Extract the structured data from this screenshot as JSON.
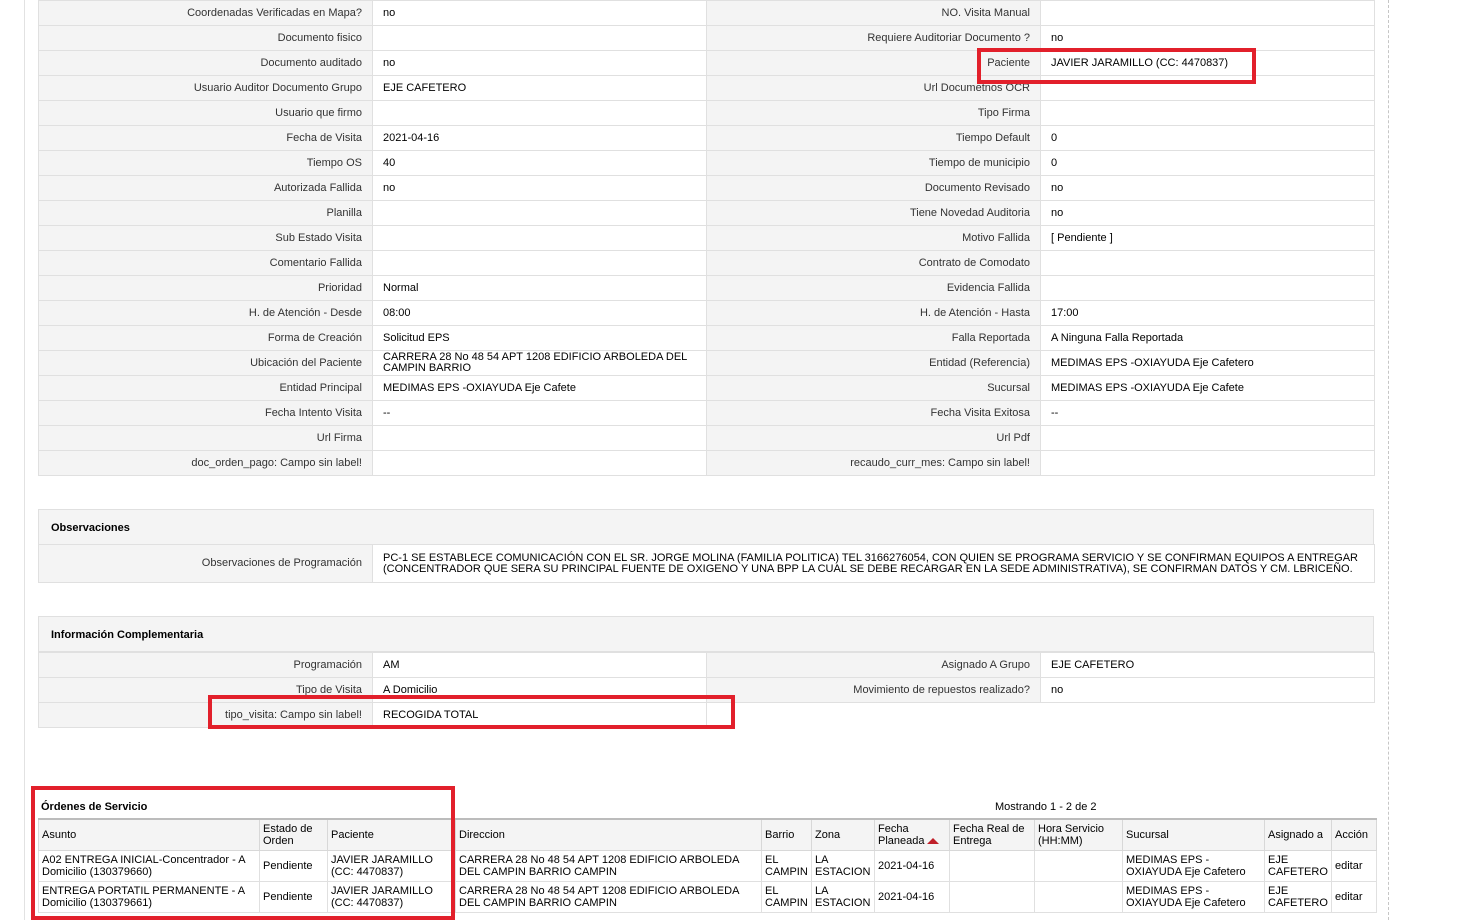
{
  "details": {
    "rows": [
      {
        "l1": "Coordenadas Verificadas en Mapa?",
        "v1": "no",
        "l2": "NO. Visita Manual",
        "v2": ""
      },
      {
        "l1": "Documento fisico",
        "v1": "",
        "l2": "Requiere Auditoriar Documento ?",
        "v2": "no"
      },
      {
        "l1": "Documento auditado",
        "v1": "no",
        "l2": "Paciente",
        "v2": "JAVIER JARAMILLO (CC: 4470837)"
      },
      {
        "l1": "Usuario Auditor Documento Grupo",
        "v1": "EJE CAFETERO",
        "l2": "Url Documetnos OCR",
        "v2": ""
      },
      {
        "l1": "Usuario que firmo",
        "v1": "",
        "l2": "Tipo Firma",
        "v2": ""
      },
      {
        "l1": "Fecha de Visita",
        "v1": " 2021-04-16",
        "l2": "Tiempo Default",
        "v2": "0"
      },
      {
        "l1": "Tiempo OS",
        "v1": "40",
        "l2": "Tiempo de municipio",
        "v2": "0"
      },
      {
        "l1": "Autorizada Fallida",
        "v1": "no",
        "l2": "Documento Revisado",
        "v2": "no"
      },
      {
        "l1": "Planilla",
        "v1": "",
        "l2": "Tiene Novedad Auditoria",
        "v2": "no"
      },
      {
        "l1": "Sub Estado Visita",
        "v1": "",
        "l2": "Motivo Fallida",
        "v2": "[ Pendiente ]"
      },
      {
        "l1": "Comentario Fallida",
        "v1": "",
        "l2": "Contrato de Comodato",
        "v2": ""
      },
      {
        "l1": "Prioridad",
        "v1": "Normal",
        "l2": "Evidencia Fallida",
        "v2": ""
      },
      {
        "l1": "H. de Atención - Desde",
        "v1": "08:00",
        "l2": "H. de Atención - Hasta",
        "v2": "17:00"
      },
      {
        "l1": "Forma de Creación",
        "v1": "Solicitud EPS",
        "l2": "Falla Reportada",
        "v2": "A Ninguna Falla Reportada"
      },
      {
        "l1": "Ubicación del Paciente",
        "v1": "CARRERA 28 No 48 54 APT 1208 EDIFICIO ARBOLEDA DEL CAMPIN BARRIO",
        "l2": "Entidad (Referencia)",
        "v2": "MEDIMAS EPS -OXIAYUDA Eje Cafetero"
      },
      {
        "l1": "Entidad Principal",
        "v1": "MEDIMAS EPS -OXIAYUDA Eje Cafete",
        "l2": "Sucursal",
        "v2": "MEDIMAS EPS -OXIAYUDA Eje Cafete"
      },
      {
        "l1": "Fecha Intento Visita",
        "v1": "--",
        "l2": "Fecha Visita Exitosa",
        "v2": "--"
      },
      {
        "l1": "Url Firma",
        "v1": "",
        "l2": "Url Pdf",
        "v2": ""
      },
      {
        "l1": "doc_orden_pago: Campo sin label!",
        "v1": "",
        "l2": "recaudo_curr_mes: Campo sin label!",
        "v2": ""
      }
    ]
  },
  "observaciones": {
    "title": "Observaciones",
    "label": "Observaciones de Programación",
    "text": "PC-1 SE ESTABLECE COMUNICACIÓN CON EL SR. JORGE MOLINA (FAMILIA POLITICA) TEL 3166276054, CON QUIEN SE PROGRAMA SERVICIO Y SE CONFIRMAN EQUIPOS A ENTREGAR (CONCENTRADOR QUE SERA SU PRINCIPAL FUENTE DE OXIGENO Y UNA BPP LA CUAL SE DEBE RECARGAR EN LA SEDE ADMINISTRATIVA), SE CONFIRMAN DATOS Y CM. LBRICEÑO."
  },
  "complementaria": {
    "title": "Información Complementaria",
    "rows": [
      {
        "l1": "Programación",
        "v1": "AM",
        "l2": "Asignado A Grupo",
        "v2": "EJE CAFETERO"
      },
      {
        "l1": "Tipo de Visita",
        "v1": "A Domicilio",
        "l2": "Movimiento de repuestos realizado?",
        "v2": "no"
      }
    ],
    "extra": {
      "label": "tipo_visita: Campo sin label!",
      "value": "RECOGIDA TOTAL"
    }
  },
  "orders": {
    "title": "Órdenes de Servicio",
    "count": "Mostrando 1 - 2 de 2",
    "headers": {
      "asunto": "Asunto",
      "estado": "Estado de Orden",
      "paciente": "Paciente",
      "direccion": "Direccion",
      "barrio": "Barrio",
      "zona": "Zona",
      "fecha_planeada": "Fecha Planeada",
      "fecha_real": "Fecha Real de Entrega",
      "hora": "Hora Servicio (HH:MM)",
      "sucursal": "Sucursal",
      "asignado": "Asignado a",
      "accion": "Acción"
    },
    "rows": [
      {
        "asunto": "A02 ENTREGA INICIAL-Concentrador - A Domicilio (130379660)",
        "estado": "Pendiente",
        "paciente": "JAVIER JARAMILLO (CC: 4470837)",
        "direccion": "CARRERA 28 No 48 54 APT 1208 EDIFICIO ARBOLEDA DEL CAMPIN BARRIO CAMPIN",
        "barrio": "EL CAMPIN",
        "zona": "LA ESTACION",
        "fecha_planeada": "2021-04-16",
        "fecha_real": "",
        "hora": "",
        "sucursal": "MEDIMAS EPS - OXIAYUDA Eje Cafetero",
        "asignado": "EJE CAFETERO",
        "accion": "editar"
      },
      {
        "asunto": "ENTREGA PORTATIL PERMANENTE - A Domicilio (130379661)",
        "estado": "Pendiente",
        "paciente": "JAVIER JARAMILLO (CC: 4470837)",
        "direccion": "CARRERA 28 No 48 54 APT 1208 EDIFICIO ARBOLEDA DEL CAMPIN BARRIO CAMPIN",
        "barrio": "EL CAMPIN",
        "zona": "LA ESTACION",
        "fecha_planeada": "2021-04-16",
        "fecha_real": "",
        "hora": "",
        "sucursal": "MEDIMAS EPS - OXIAYUDA Eje Cafetero",
        "asignado": "EJE CAFETERO",
        "accion": "editar"
      }
    ]
  },
  "colors": {
    "highlight": "#e2202b",
    "label_bg": "#f4f4f4",
    "sort_arrow": "#c0202a"
  }
}
